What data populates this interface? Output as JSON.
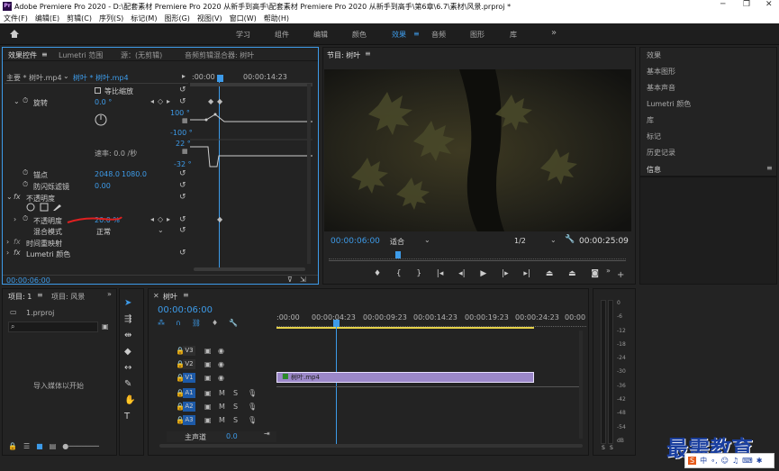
{
  "app": {
    "title": "Adobe Premiere Pro 2020 - D:\\配套素材 Premiere Pro 2020 从新手到高手\\配套素材 Premiere Pro 2020 从新手到高手\\第6章\\6.7\\素材\\风景.prproj *",
    "logo": "Pr"
  },
  "menu": [
    "文件(F)",
    "编辑(E)",
    "剪辑(C)",
    "序列(S)",
    "标记(M)",
    "图形(G)",
    "视图(V)",
    "窗口(W)",
    "帮助(H)"
  ],
  "workspaces": {
    "items": [
      "学习",
      "组件",
      "编辑",
      "颜色",
      "效果",
      "音频",
      "图形",
      "库"
    ],
    "active": "效果",
    "more": "»"
  },
  "effect_controls": {
    "tabs": [
      "效果控件",
      "Lumetri 范围",
      "源：(无剪辑)",
      "音频剪辑混合器: 树叶"
    ],
    "master": "主要 * 树叶.mp4",
    "clip": "树叶 * 树叶.mp4",
    "tc_start": ":00:00",
    "tc_end": "00:00:14:23",
    "uniform_scale": "等比缩放",
    "rotation_label": "旋转",
    "rotation_value": "0.0 °",
    "graph_vals": [
      "100 °",
      "-100 °",
      "22 °",
      "-32 °"
    ],
    "velocity": "速率: 0.0 /秒",
    "anchor_label": "锚点",
    "anchor_x": "2048.0",
    "anchor_y": "1080.0",
    "flicker_label": "防闪烁滤镜",
    "flicker_value": "0.00",
    "opacity_section": "不透明度",
    "opacity_label": "不透明度",
    "opacity_value": "20.0 %",
    "blend_label": "混合模式",
    "blend_value": "正常",
    "time_remap": "时间重映射",
    "lumetri": "Lumetri 颜色",
    "timecode": "00:00:06:00"
  },
  "program": {
    "title": "节目: 树叶",
    "timecode": "00:00:06:00",
    "fit": "适合",
    "quality": "1/2",
    "duration": "00:00:25:09"
  },
  "right_panel": {
    "items": [
      "效果",
      "基本图形",
      "基本声音",
      "Lumetri 颜色",
      "库",
      "标记",
      "历史记录",
      "信息"
    ],
    "active": "信息"
  },
  "project": {
    "tabs": [
      "项目: 1",
      "项目: 风景"
    ],
    "file": "1.prproj",
    "empty": "导入媒体以开始"
  },
  "timeline": {
    "tab": "树叶",
    "timecode": "00:00:06:00",
    "ruler": [
      ":00:00",
      "00:00:04:23",
      "00:00:09:23",
      "00:00:14:23",
      "00:00:19:23",
      "00:00:24:23",
      "00:00"
    ],
    "video_tracks": [
      "V3",
      "V2",
      "V1"
    ],
    "audio_tracks": [
      "A1",
      "A2",
      "A3"
    ],
    "mute": "M",
    "solo": "S",
    "master": "主声道",
    "master_val": "0.0",
    "clip": "树叶.mp4"
  },
  "meter": {
    "scale": [
      "0",
      "-6",
      "-12",
      "-18",
      "-24",
      "-30",
      "-36",
      "-42",
      "-48",
      "-54",
      "dB"
    ],
    "solo": [
      "S",
      "S"
    ]
  },
  "watermark": "最需教育",
  "ime": "中",
  "colors": {
    "accent": "#3d9be9",
    "clip": "#9b87c9",
    "annotation": "#e02020",
    "watermark": "#1a3fa0"
  }
}
